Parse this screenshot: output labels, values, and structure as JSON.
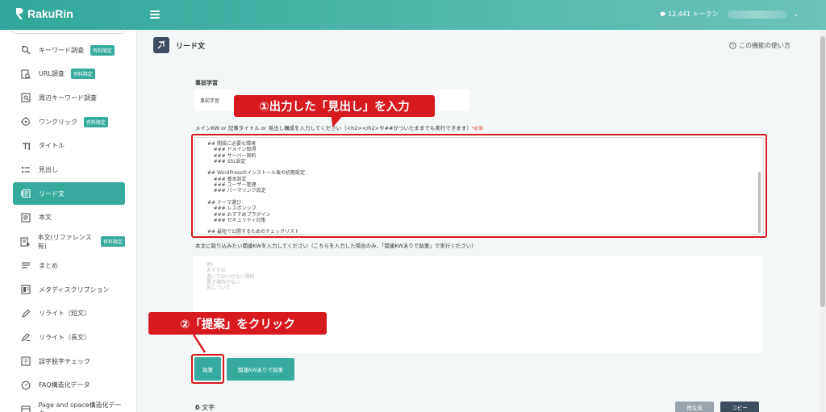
{
  "app": {
    "name": "RakuRin"
  },
  "header": {
    "tokens": "12,441 トークン",
    "token_icon": "chat-bubble-icon",
    "user_chevron": "⌄"
  },
  "sidebar": {
    "items": [
      {
        "label": "キーワード調査",
        "badge": "有料限定",
        "icon": "keyword-search-icon"
      },
      {
        "label": "URL調査",
        "badge": "有料限定",
        "icon": "url-search-icon"
      },
      {
        "label": "周辺キーワード調査",
        "badge": "",
        "icon": "related-keyword-icon"
      },
      {
        "label": "ワンクリック",
        "badge": "有料限定",
        "icon": "one-click-icon"
      },
      {
        "label": "タイトル",
        "badge": "",
        "icon": "title-icon"
      },
      {
        "label": "見出し",
        "badge": "",
        "icon": "heading-icon"
      },
      {
        "label": "リード文",
        "badge": "",
        "icon": "lead-text-icon"
      },
      {
        "label": "本文",
        "badge": "",
        "icon": "body-text-icon"
      },
      {
        "label": "本文(リファレンス有)",
        "badge": "有料限定",
        "icon": "body-reference-icon"
      },
      {
        "label": "まとめ",
        "badge": "",
        "icon": "summary-icon"
      },
      {
        "label": "メタディスクリプション",
        "badge": "",
        "icon": "meta-description-icon"
      },
      {
        "label": "リライト（短文）",
        "badge": "",
        "icon": "rewrite-short-icon"
      },
      {
        "label": "リライト（長文）",
        "badge": "",
        "icon": "rewrite-long-icon"
      },
      {
        "label": "誤字脱字チェック",
        "badge": "",
        "icon": "typo-check-icon"
      },
      {
        "label": "FAQ構造化データ",
        "badge": "",
        "icon": "faq-icon"
      },
      {
        "label": "Page and space構造化データ",
        "badge": "",
        "icon": "structured-data-icon"
      }
    ],
    "active_index": 6
  },
  "page": {
    "title": "リード文",
    "help": "この機能の使い方",
    "prelearn_label": "事前学習",
    "prelearn_value": "事前学習",
    "kw_label": "メインKW or 記事タイトル or 見出し構成を入力してください（<h2></h2>や##がついたままでも実行できます）",
    "kw_required": "*必須",
    "headings_text": "## 開設に必要な環境\n    ### ドメイン取得\n    ### サーバー契約\n    ### SSL設定\n\n## WordPressのインストール後の初期設定\n    ### 基本設定\n    ### ユーザー管理\n    ### パーマリンク設定\n\n## テーマ選び\n    ### レスポンシブ\n    ### おすすめプラグイン\n    ### セキュリティ対策\n\n## 最短で公開するためのチェックリスト",
    "related_label": "本文に取り込みたい関連KWを入力してください（こちらを入力した場合のみ、「関連KWありで執筆」で実行ください）",
    "related_placeholder": "例）\nおすすめ\n書いてはいけない場所\n置き場所がない\n窓について",
    "exec_button": "執筆",
    "exec_kw_button": "関連KWありで執筆",
    "char_count": "0",
    "char_unit": "文字",
    "regen_button": "再生成",
    "copy_button": "コピー"
  },
  "callouts": {
    "step1": "①出力した「見出し」を入力",
    "step2": "②「提案」をクリック",
    "color": "#d71920"
  },
  "colors": {
    "accent": "#36ab9d",
    "header_start": "#30a79a",
    "header_end": "#6cc3b8",
    "dark": "#3d4c5f"
  }
}
